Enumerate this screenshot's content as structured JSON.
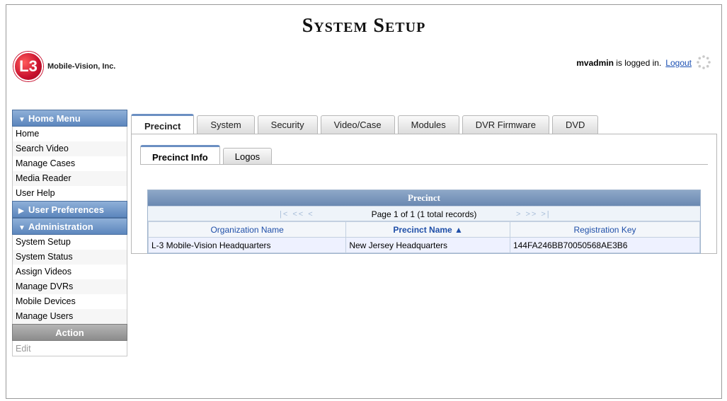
{
  "header": {
    "title": "System Setup",
    "logo_mark": "L3",
    "company": "Mobile-Vision, Inc.",
    "username": "mvadmin",
    "logged_in_suffix": " is logged in.",
    "logout": "Logout"
  },
  "sidebar": {
    "home_menu": {
      "label": "Home Menu",
      "items": [
        "Home",
        "Search Video",
        "Manage Cases",
        "Media Reader",
        "User Help"
      ]
    },
    "user_prefs": {
      "label": "User Preferences"
    },
    "administration": {
      "label": "Administration",
      "items": [
        "System Setup",
        "System Status",
        "Assign Videos",
        "Manage DVRs",
        "Mobile Devices",
        "Manage Users"
      ]
    },
    "action": {
      "label": "Action",
      "items": [
        "Edit"
      ]
    }
  },
  "tabs": [
    "Precinct",
    "System",
    "Security",
    "Video/Case",
    "Modules",
    "DVR Firmware",
    "DVD"
  ],
  "subtabs": [
    "Precinct Info",
    "Logos"
  ],
  "grid": {
    "title": "Precinct",
    "pager_text": "Page 1 of 1 (1 total records)",
    "nav_left": "|< << <",
    "nav_right": "> >> >|",
    "columns": [
      "Organization Name",
      "Precinct Name ▲",
      "Registration Key"
    ],
    "rows": [
      [
        "L-3 Mobile-Vision Headquarters",
        "New Jersey Headquarters",
        "144FA246BB70050568AE3B6"
      ]
    ]
  }
}
